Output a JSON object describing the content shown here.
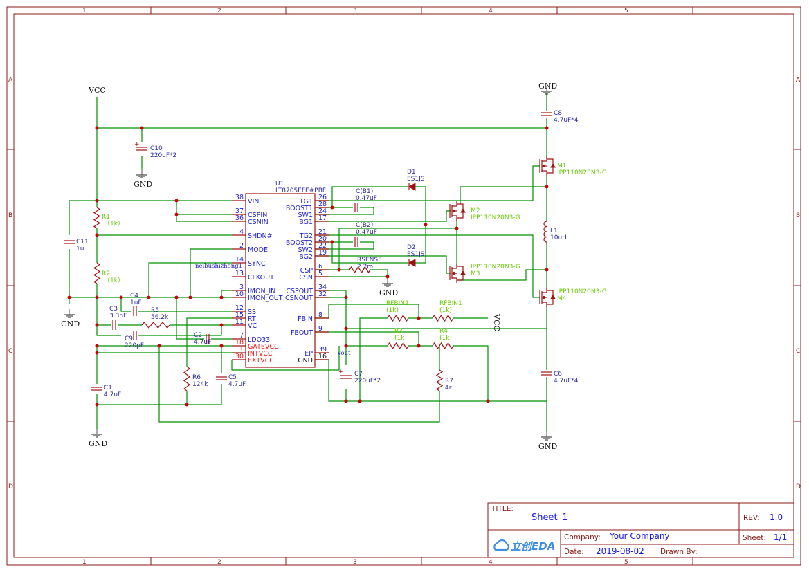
{
  "frame": {
    "columns": [
      "1",
      "2",
      "3",
      "4",
      "5"
    ],
    "rows": [
      "A",
      "B",
      "C",
      "D"
    ]
  },
  "power": {
    "vcc": "VCC",
    "gnd": "GND"
  },
  "ic": {
    "designator": "U1",
    "part": "LT8705EFE#PBF",
    "left_pins": [
      {
        "num": "38",
        "name": "VIN"
      },
      {
        "num": "37",
        "name": "CSPIN"
      },
      {
        "num": "36",
        "name": "CSNIN"
      },
      {
        "num": "4",
        "name": "SHDN#"
      },
      {
        "num": "2",
        "name": "MODE"
      },
      {
        "num": "14",
        "name": "SYNC"
      },
      {
        "num": "13",
        "name": "CLKOUT"
      },
      {
        "num": "3",
        "name": "IMON_IN"
      },
      {
        "num": "10",
        "name": "IMON_OUT"
      },
      {
        "num": "12",
        "name": "SS"
      },
      {
        "num": "15",
        "name": "RT"
      },
      {
        "num": "11",
        "name": "VC"
      },
      {
        "num": "7",
        "name": "LDO33"
      },
      {
        "num": "18",
        "name": "GATEVCC"
      },
      {
        "num": "1",
        "name": "INTVCC"
      },
      {
        "num": "30",
        "name": "EXTVCC"
      }
    ],
    "right_pins": [
      {
        "num": "26",
        "name": "TG1"
      },
      {
        "num": "28",
        "name": "BOOST1"
      },
      {
        "num": "24",
        "name": "SW1"
      },
      {
        "num": "17",
        "name": "BG1"
      },
      {
        "num": "21",
        "name": "TG2"
      },
      {
        "num": "20",
        "name": "BOOST2"
      },
      {
        "num": "22",
        "name": "SW2"
      },
      {
        "num": "19",
        "name": "BG2"
      },
      {
        "num": "6",
        "name": "CSP"
      },
      {
        "num": "5",
        "name": "CSN"
      },
      {
        "num": "34",
        "name": "CSPOUT"
      },
      {
        "num": "32",
        "name": "CSNOUT"
      },
      {
        "num": "8",
        "name": "FBIN"
      },
      {
        "num": "9",
        "name": "FBOUT"
      },
      {
        "num": "39",
        "name": "EP"
      },
      {
        "num": "16",
        "name": "GND"
      }
    ]
  },
  "components": [
    {
      "id": "C10",
      "value": "220uF*2"
    },
    {
      "id": "R1",
      "value": "（1k）"
    },
    {
      "id": "R2",
      "value": "（1k）"
    },
    {
      "id": "C11",
      "value": "1u"
    },
    {
      "id": "C4",
      "value": "1uF"
    },
    {
      "id": "C3",
      "value": "3.3nF"
    },
    {
      "id": "R5",
      "value": "56.2k"
    },
    {
      "id": "C9",
      "value": "220pF"
    },
    {
      "id": "C2",
      "value": "4.7uF"
    },
    {
      "id": "R6",
      "value": "124k"
    },
    {
      "id": "C5",
      "value": "4.7uF"
    },
    {
      "id": "C1",
      "value": "4.7uF"
    },
    {
      "id": "D1",
      "value": "ES1JS"
    },
    {
      "id": "C(B1)",
      "value": "0.47uF"
    },
    {
      "id": "C(B2)",
      "value": "0.47uF"
    },
    {
      "id": "D2",
      "value": "ES1JS"
    },
    {
      "id": "RSENSE",
      "value": "2.2m"
    },
    {
      "id": "RFBIN2",
      "value": "(1k)"
    },
    {
      "id": "RFBIN1",
      "value": "(1k)"
    },
    {
      "id": "R3",
      "value": "(1k)"
    },
    {
      "id": "R4",
      "value": "(1k)"
    },
    {
      "id": "C7",
      "value": "220uF*2"
    },
    {
      "id": "R7",
      "value": "4r"
    },
    {
      "id": "C8",
      "value": "4.7uF*4"
    },
    {
      "id": "M1",
      "value": "IPP110N20N3-G"
    },
    {
      "id": "M2",
      "value": "IPP110N20N3-G"
    },
    {
      "id": "M3",
      "value": "IPP110N20N3-G"
    },
    {
      "id": "M4",
      "value": "IPP110N20N3-G"
    },
    {
      "id": "L1",
      "value": "10uH"
    },
    {
      "id": "C6",
      "value": "4.7uF*4"
    }
  ],
  "nets": {
    "sync_net": "neibushizhong1",
    "vout": "Vout"
  },
  "title_block": {
    "title_label": "TITLE:",
    "title": "Sheet_1",
    "rev_label": "REV:",
    "rev": "1.0",
    "company_label": "Company:",
    "company": "Your Company",
    "sheet_label": "Sheet:",
    "sheet": "1/1",
    "date_label": "Date:",
    "date": "2019-08-02",
    "drawn_by_label": "Drawn By:",
    "drawn_by": "",
    "logo_text": "立创EDA"
  },
  "colors": {
    "frame": "#8b1a1a",
    "wire": "#009000",
    "symbol": "#a01010",
    "junction": "#cc0000",
    "designator": "#2a2aa0",
    "green_value": "#66cc00",
    "power_pin_name": "#ff1111",
    "title_value": "#1a1aee"
  }
}
